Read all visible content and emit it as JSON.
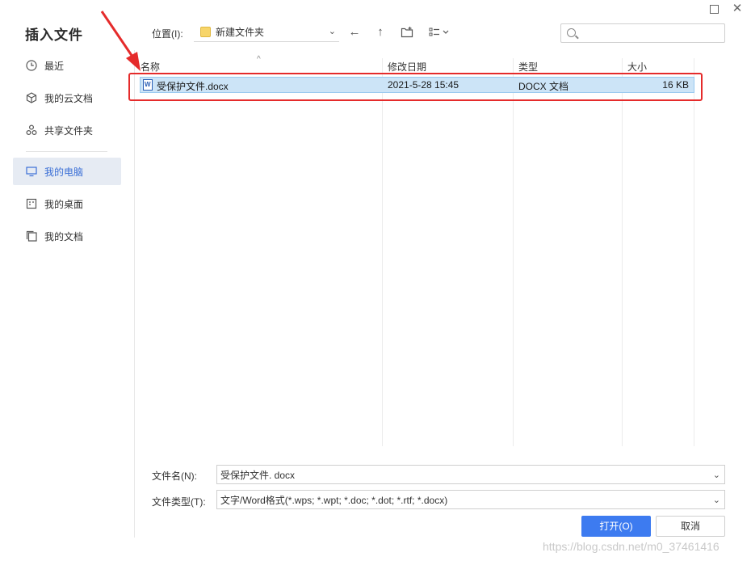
{
  "dialog": {
    "title": "插入文件"
  },
  "sidebar": {
    "items": [
      {
        "label": "最近",
        "icon": "clock-icon"
      },
      {
        "label": "我的云文档",
        "icon": "cloud-cube-icon"
      },
      {
        "label": "共享文件夹",
        "icon": "share-circles-icon"
      },
      {
        "label": "我的电脑",
        "icon": "monitor-icon",
        "active": true
      },
      {
        "label": "我的桌面",
        "icon": "desktop-icon"
      },
      {
        "label": "我的文档",
        "icon": "documents-icon"
      }
    ]
  },
  "toolbar": {
    "location_label": "位置(I):",
    "location_value": "新建文件夹",
    "back_icon": "←",
    "up_icon": "↑"
  },
  "search": {
    "placeholder": ""
  },
  "file_list": {
    "columns": [
      "名称",
      "修改日期",
      "类型",
      "大小"
    ],
    "rows": [
      {
        "name": "受保护文件.docx",
        "modified": "2021-5-28 15:45",
        "type": "DOCX 文档",
        "size": "16 KB"
      }
    ]
  },
  "filename": {
    "label": "文件名(N):",
    "value": "受保护文件. docx"
  },
  "filetype": {
    "label": "文件类型(T):",
    "value": "文字/Word格式(*.wps; *.wpt; *.doc; *.dot; *.rtf; *.docx)"
  },
  "buttons": {
    "open": "打开(O)",
    "cancel": "取消"
  },
  "watermark": "https://blog.csdn.net/m0_37461416",
  "colors": {
    "accent": "#3d7bf0",
    "selection": "#cce4f7",
    "annotation": "#e52b2b"
  }
}
